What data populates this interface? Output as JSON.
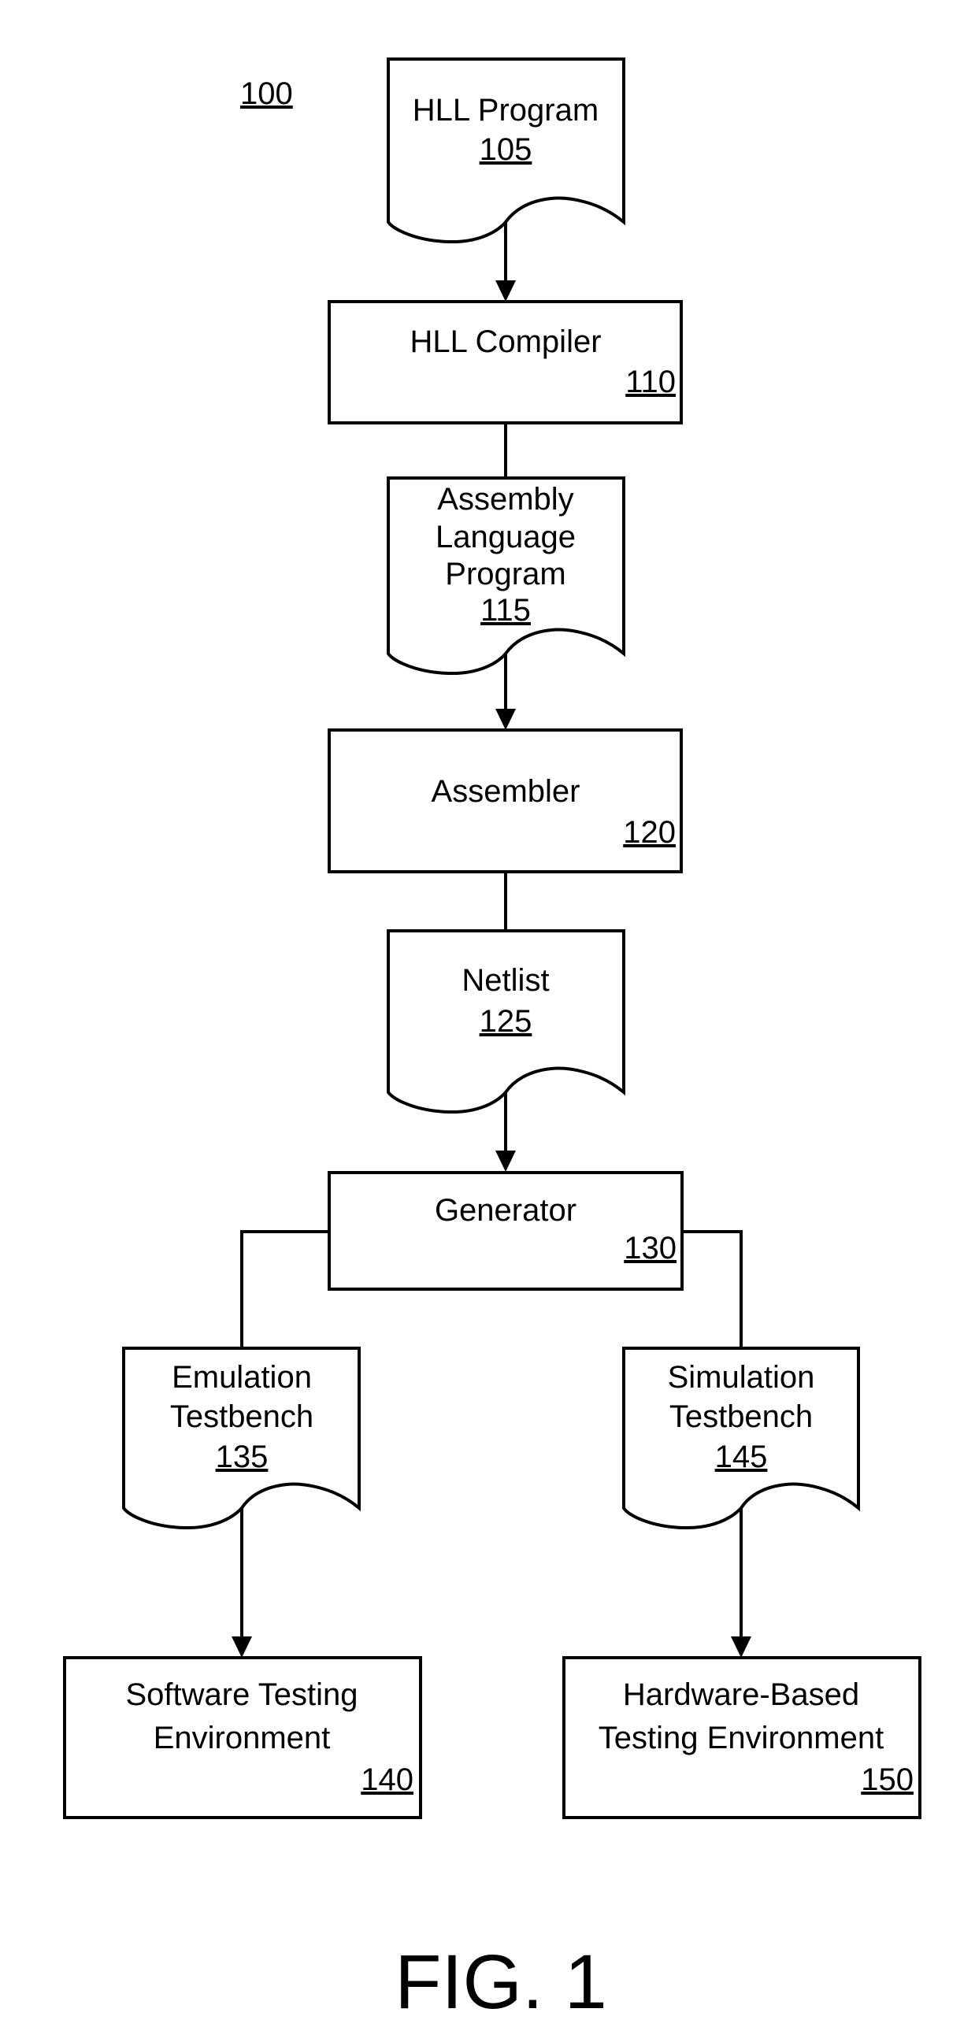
{
  "figure": {
    "ref": "100",
    "caption": "FIG. 1"
  },
  "nodes": {
    "hll_program": {
      "kind": "document",
      "lines": [
        "HLL Program"
      ],
      "ref": "105"
    },
    "hll_compiler": {
      "kind": "process",
      "lines": [
        "HLL Compiler"
      ],
      "ref": "110"
    },
    "assembly_program": {
      "kind": "document",
      "lines": [
        "Assembly",
        "Language",
        "Program"
      ],
      "ref": "115"
    },
    "assembler": {
      "kind": "process",
      "lines": [
        "Assembler"
      ],
      "ref": "120"
    },
    "netlist": {
      "kind": "document",
      "lines": [
        "Netlist"
      ],
      "ref": "125"
    },
    "generator": {
      "kind": "process",
      "lines": [
        "Generator"
      ],
      "ref": "130"
    },
    "emulation_testbench": {
      "kind": "document",
      "lines": [
        "Emulation",
        "Testbench"
      ],
      "ref": "135"
    },
    "software_env": {
      "kind": "process",
      "lines": [
        "Software Testing",
        "Environment"
      ],
      "ref": "140"
    },
    "simulation_testbench": {
      "kind": "document",
      "lines": [
        "Simulation",
        "Testbench"
      ],
      "ref": "145"
    },
    "hardware_env": {
      "kind": "process",
      "lines": [
        "Hardware-Based",
        "Testing Environment"
      ],
      "ref": "150"
    }
  },
  "edges": [
    {
      "from": "hll_program",
      "to": "hll_compiler",
      "arrow": true
    },
    {
      "from": "hll_compiler",
      "to": "assembly_program",
      "arrow": false
    },
    {
      "from": "assembly_program",
      "to": "assembler",
      "arrow": true
    },
    {
      "from": "assembler",
      "to": "netlist",
      "arrow": false
    },
    {
      "from": "netlist",
      "to": "generator",
      "arrow": true
    },
    {
      "from": "generator",
      "to": "emulation_testbench",
      "arrow": false
    },
    {
      "from": "generator",
      "to": "simulation_testbench",
      "arrow": false
    },
    {
      "from": "emulation_testbench",
      "to": "software_env",
      "arrow": true
    },
    {
      "from": "simulation_testbench",
      "to": "hardware_env",
      "arrow": true
    }
  ]
}
